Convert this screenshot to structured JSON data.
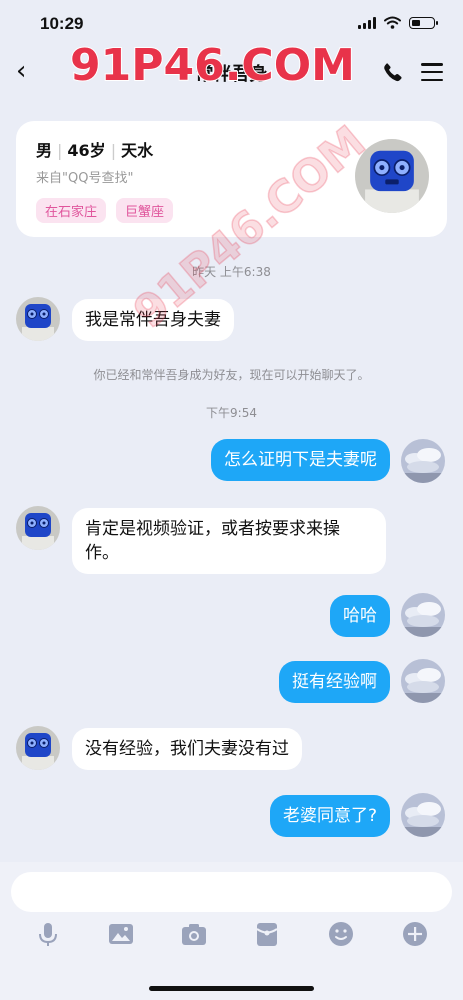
{
  "status": {
    "time": "10:29",
    "battery_level": 0.35
  },
  "header": {
    "title": "常伴吾身"
  },
  "profile": {
    "gender": "男",
    "age": "46岁",
    "location": "天水",
    "source": "来自\"QQ号查找\"",
    "tags": [
      "在石家庄",
      "巨蟹座"
    ]
  },
  "messages": {
    "ts1": "昨天 上午6:38",
    "m1": "我是常伴吾身夫妻",
    "system": "你已经和常伴吾身成为好友，现在可以开始聊天了。",
    "ts2": "下午9:54",
    "m2": "怎么证明下是夫妻呢",
    "m3": "肯定是视频验证，或者按要求来操作。",
    "m4": "哈哈",
    "m5": "挺有经验啊",
    "m6": "没有经验，我们夫妻没有过",
    "m7": "老婆同意了?"
  },
  "watermark": "91P46.COM",
  "colors": {
    "outgoing": "#1ea7f7",
    "tag_bg": "#fbe3f0",
    "tag_text": "#e0559c"
  },
  "toolbar_icons": [
    "microphone-icon",
    "image-icon",
    "camera-icon",
    "red-packet-icon",
    "emoji-icon",
    "plus-icon"
  ]
}
